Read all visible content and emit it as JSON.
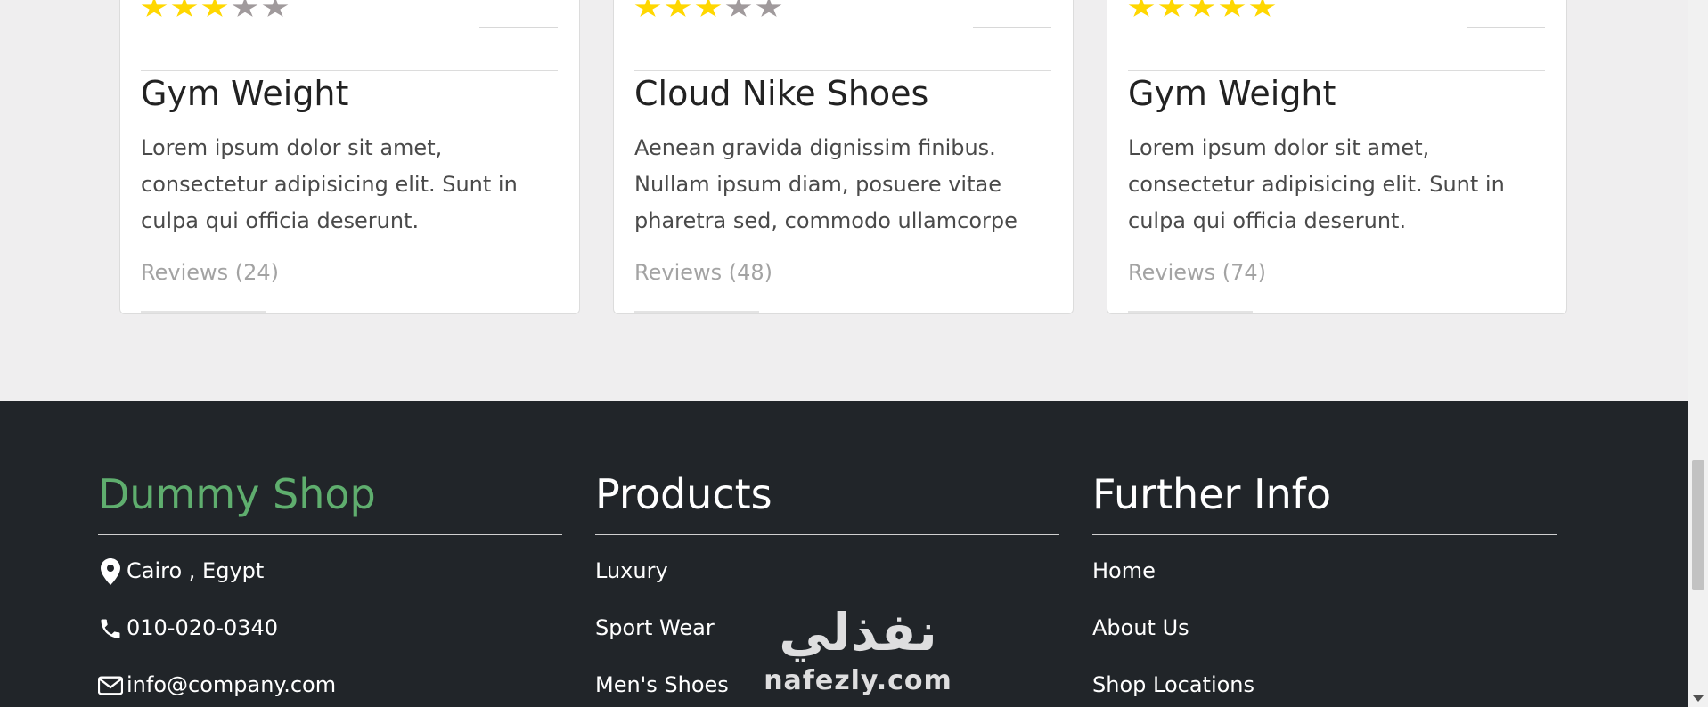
{
  "cards": [
    {
      "title": "Gym Weight",
      "description": "Lorem ipsum dolor sit amet, consectetur adipisicing elit. Sunt in culpa qui officia deserunt.",
      "reviews": "Reviews (24)",
      "rating": 3,
      "max_rating": 5
    },
    {
      "title": "Cloud Nike Shoes",
      "description": "Aenean gravida dignissim finibus. Nullam ipsum diam, posuere vitae pharetra sed, commodo ullamcorpe",
      "reviews": "Reviews (48)",
      "rating": 3,
      "max_rating": 5
    },
    {
      "title": "Gym Weight",
      "description": "Lorem ipsum dolor sit amet, consectetur adipisicing elit. Sunt in culpa qui officia deserunt.",
      "reviews": "Reviews (74)",
      "rating": 5,
      "max_rating": 5
    }
  ],
  "footer": {
    "brand": {
      "title": "Dummy Shop",
      "color": "#5fae6e",
      "items": [
        {
          "icon": "map-marker-icon",
          "text": "Cairo , Egypt"
        },
        {
          "icon": "phone-icon",
          "text": "010-020-0340"
        },
        {
          "icon": "envelope-icon",
          "text": "info@company.com"
        }
      ]
    },
    "products": {
      "title": "Products",
      "items": [
        "Luxury",
        "Sport Wear",
        "Men's Shoes"
      ]
    },
    "info": {
      "title": "Further Info",
      "items": [
        "Home",
        "About Us",
        "Shop Locations"
      ]
    }
  },
  "watermark": {
    "arabic": "نفذلي",
    "latin": "nafezly.com"
  },
  "colors": {
    "star_on": "#ffd700",
    "star_off": "#a09a9c",
    "footer_bg": "#212529",
    "page_bg": "#efeeef"
  }
}
